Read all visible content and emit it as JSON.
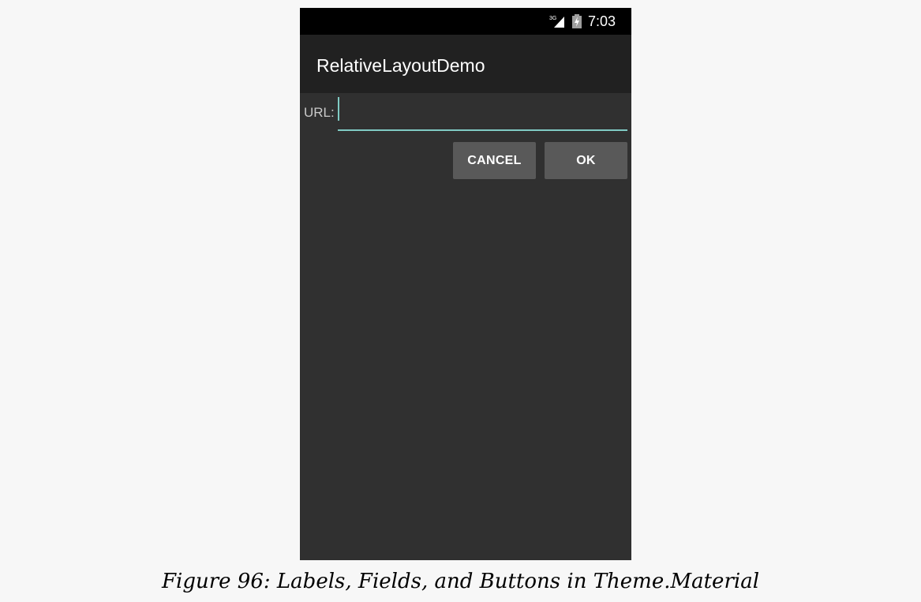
{
  "status_bar": {
    "network_label": "3G",
    "time": "7:03",
    "icons": [
      "signal-icon",
      "battery-charging-icon"
    ]
  },
  "app_bar": {
    "title": "RelativeLayoutDemo"
  },
  "form": {
    "url_label": "URL:",
    "url_value": "",
    "cancel_label": "CANCEL",
    "ok_label": "OK"
  },
  "caption": "Figure 96: Labels, Fields, and Buttons in Theme.Material",
  "colors": {
    "page_background": "#f7f7f7",
    "window_background": "#303030",
    "status_bar": "#000000",
    "app_bar": "#212121",
    "accent": "#80cbc4",
    "button": "#595959",
    "text_primary": "#ffffff",
    "text_secondary": "#c9c9c9"
  }
}
